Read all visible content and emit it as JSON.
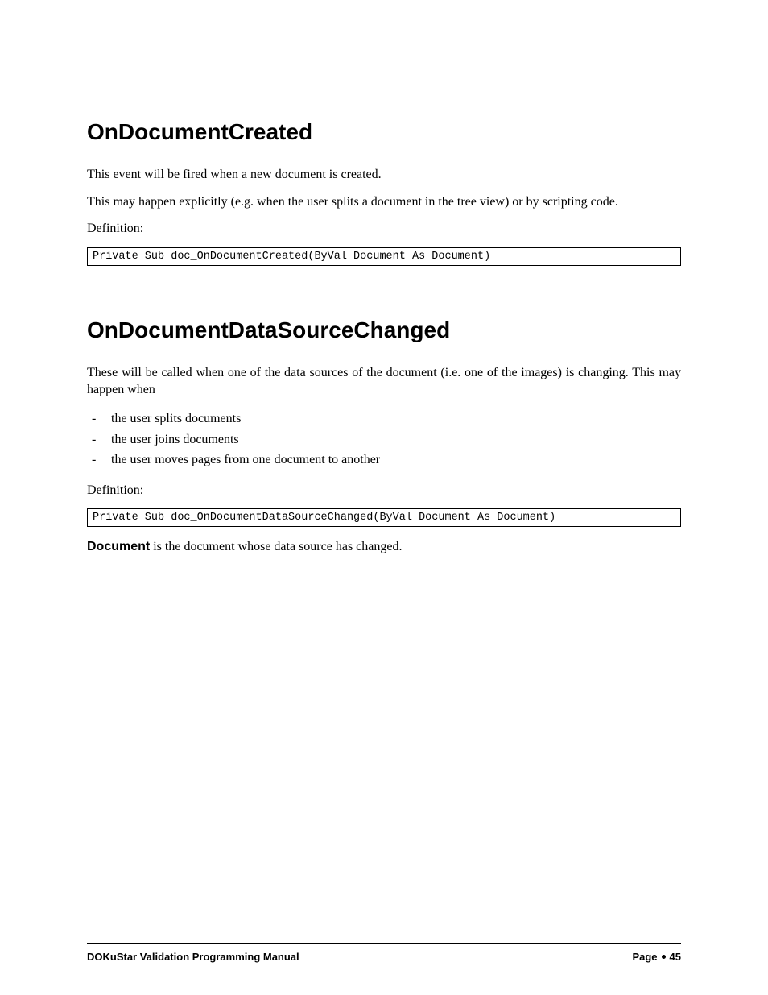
{
  "section1": {
    "heading": "OnDocumentCreated",
    "p1": "This event will be fired when a new document is created.",
    "p2": "This may happen explicitly (e.g. when the user splits a document in the tree view) or by scripting code.",
    "def_label": "Definition:",
    "code": "Private Sub doc_OnDocumentCreated(ByVal Document As Document)"
  },
  "section2": {
    "heading": "OnDocumentDataSourceChanged",
    "p1": "These will be called when one of the data sources of the document (i.e. one of the images) is changing. This may happen when",
    "bullets": [
      "the user splits documents",
      "the user joins documents",
      "the user moves pages from one document to another"
    ],
    "def_label": "Definition:",
    "code": "Private Sub doc_OnDocumentDataSourceChanged(ByVal Document As Document)",
    "note_bold": "Document",
    "note_rest": " is the document whose data source has changed."
  },
  "footer": {
    "left": "DOKuStar Validation Programming Manual",
    "right_label": "Page",
    "right_num": "45"
  }
}
